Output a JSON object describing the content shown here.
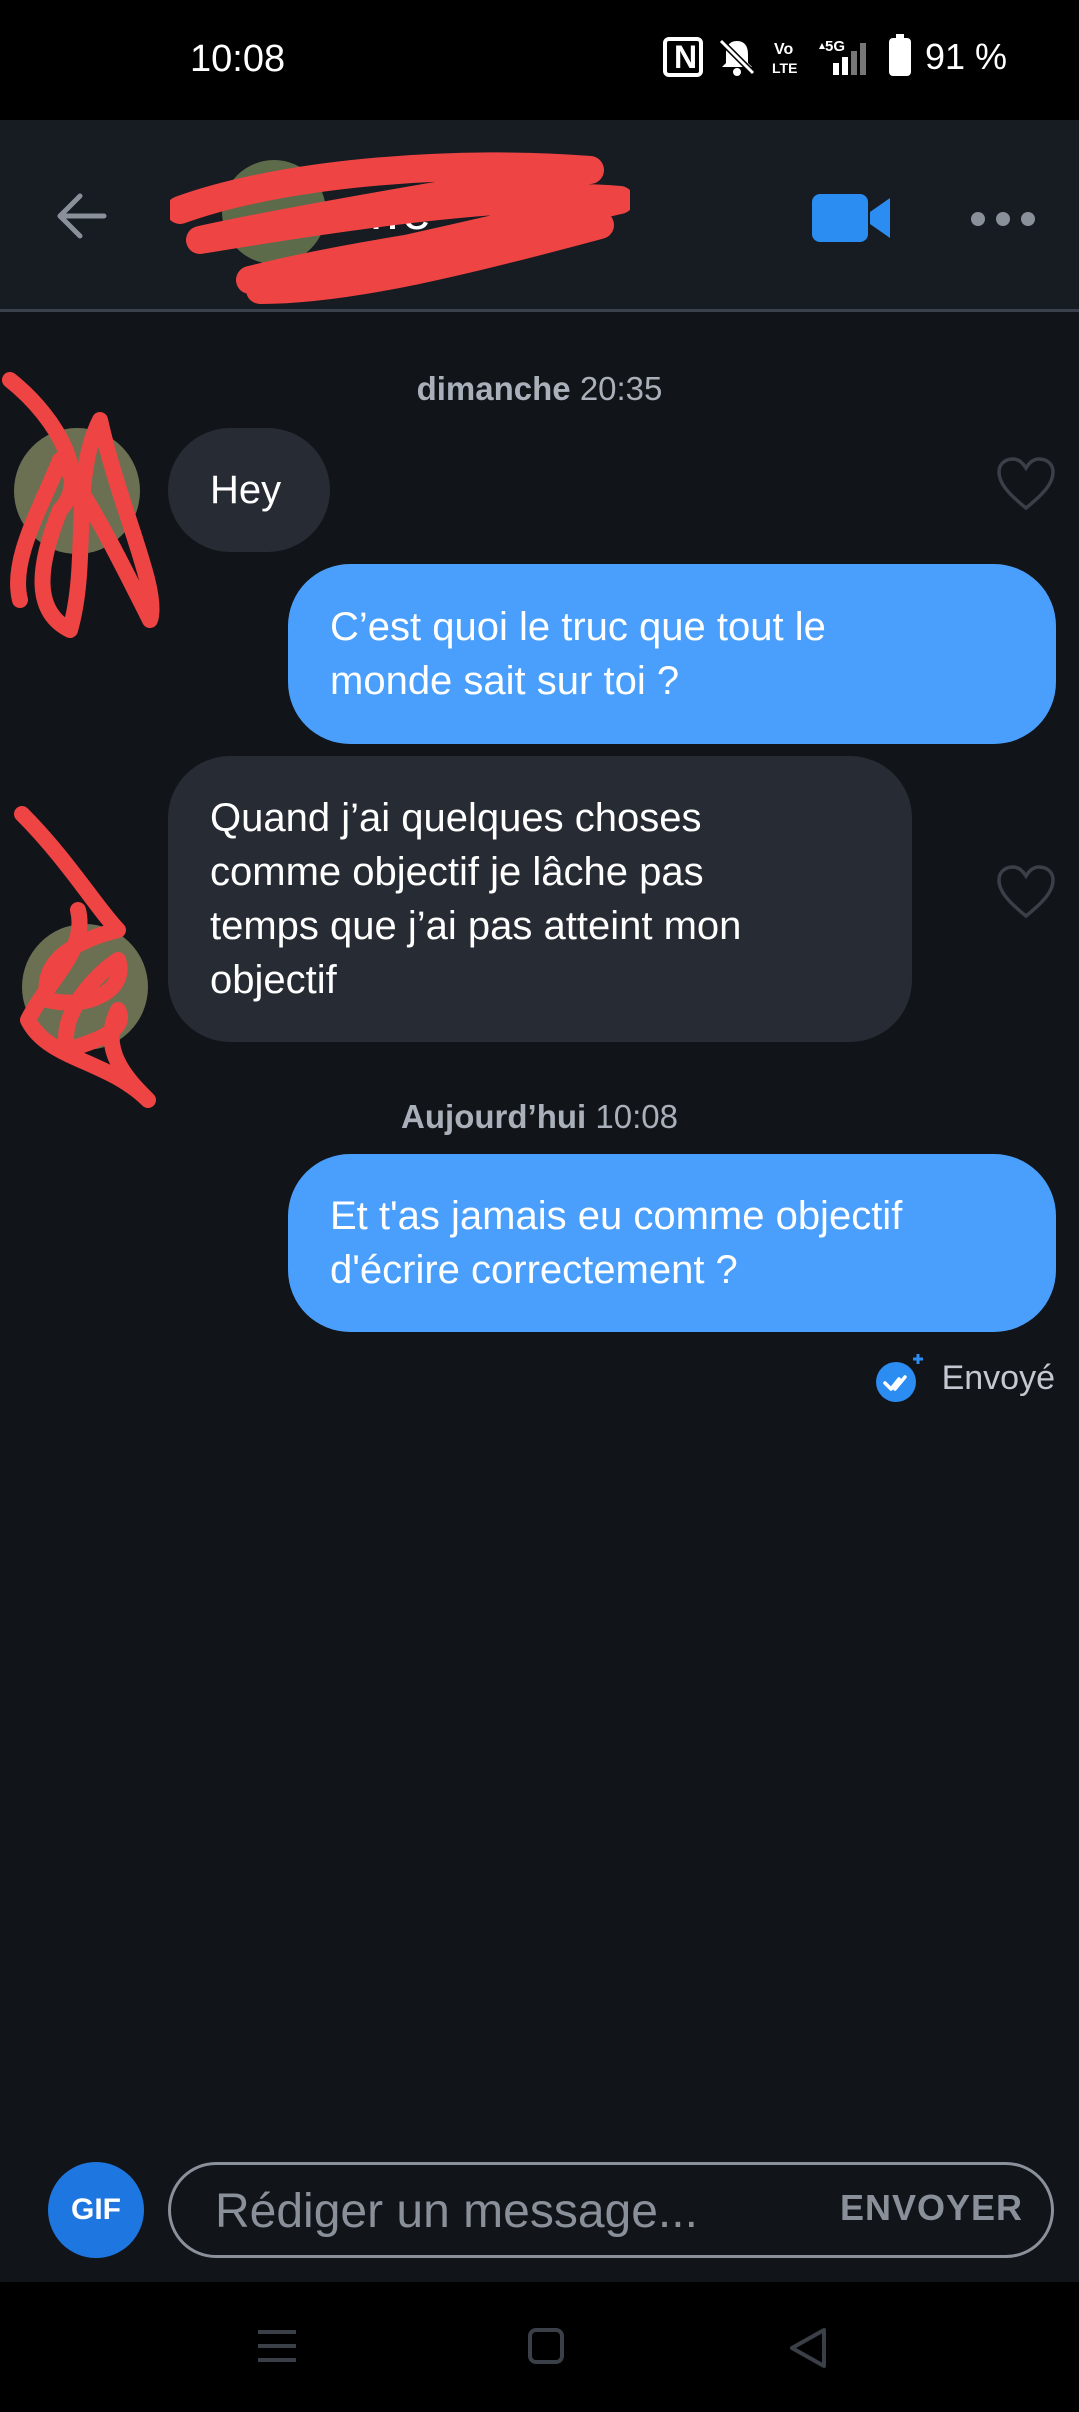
{
  "status_bar": {
    "time": "10:08",
    "battery": "91 %",
    "network": "5G"
  },
  "header": {
    "contact_name": "…e",
    "video_color": "#2b8cf2"
  },
  "conversation": {
    "timestamps": [
      {
        "day": "dimanche",
        "time": "20:35"
      },
      {
        "day": "Aujourd’hui",
        "time": "10:08"
      }
    ],
    "messages": [
      {
        "direction": "in",
        "text": "Hey"
      },
      {
        "direction": "out",
        "text_lines": [
          "C’est quoi le truc que tout le",
          "monde sait sur toi ?"
        ]
      },
      {
        "direction": "in",
        "text_lines": [
          "Quand j’ai quelques choses",
          "comme objectif je lâche pas",
          "temps que j’ai pas atteint mon",
          "objectif"
        ]
      },
      {
        "direction": "out",
        "text_lines": [
          "Et t'as jamais eu comme objectif",
          "d'écrire correctement ?"
        ]
      }
    ],
    "sent_status": "Envoyé"
  },
  "composer": {
    "gif_label": "GIF",
    "placeholder": "Rédiger un message...",
    "send_label": "ENVOYER"
  },
  "colors": {
    "outgoing_bubble": "#4a9ffc",
    "incoming_bubble": "#272b33",
    "background": "#111419",
    "accent": "#1e76e0"
  }
}
